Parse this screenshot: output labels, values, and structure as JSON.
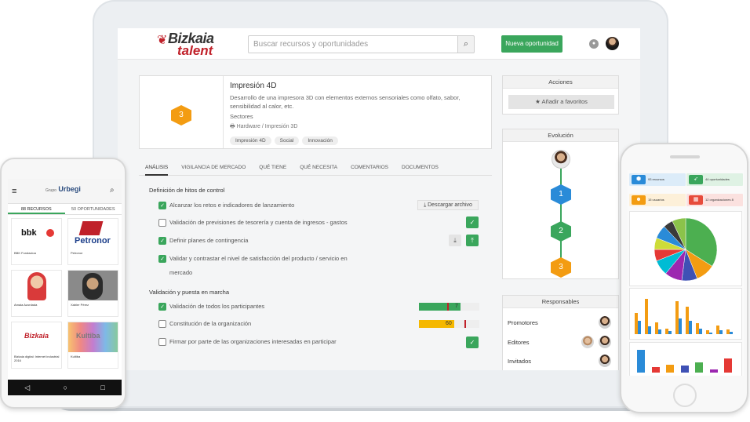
{
  "laptop": {
    "header": {
      "logo_top": "Bizkaia",
      "logo_bottom": "talent",
      "search_placeholder": "Buscar recursos y oportunidades",
      "new_button": "Nueva oportunidad"
    },
    "project": {
      "number": "3",
      "title": "Impresión 4D",
      "description": "Desarrollo de una impresora 3D con elementos externos sensoriales como olfato, sabor, sensibilidad al calor, etc.",
      "sectors_label": "Sectores",
      "category": "Hardware / Impresión 3D",
      "tags": [
        "Impresión 4D",
        "Social",
        "Innovación"
      ]
    },
    "tabs": [
      "ANÁLISIS",
      "VIGILANCIA DE MERCADO",
      "QUÉ TIENE",
      "QUÉ NECESITA",
      "COMENTARIOS",
      "DOCUMENTOS"
    ],
    "section1": {
      "title": "Definición de hitos de control",
      "items": [
        {
          "text": "Alcanzar los retos e indicadores de lanzamiento",
          "checked": true
        },
        {
          "text": "Validación de previsiones de tesorería y cuenta de ingresos - gastos",
          "checked": false
        },
        {
          "text": "Definir planes de contingencia",
          "checked": true
        },
        {
          "text": "Validar y contrastar el nivel de satisfacción del producto / servicio en",
          "checked": true
        },
        {
          "text": "mercado"
        }
      ],
      "download_button": "Descargar archivo"
    },
    "section2": {
      "title": "Validación y puesta en marcha",
      "items": [
        {
          "text": "Validación de todos los participantes",
          "checked": true,
          "score": "7"
        },
        {
          "text": "Constitución de la organización",
          "checked": false,
          "score": "60"
        },
        {
          "text": "Firmar por parte de las organizaciones interesadas en participar",
          "checked": false
        }
      ]
    },
    "sidebar": {
      "actions_title": "Acciones",
      "favorite_button": "Añadir a favoritos",
      "evolution_title": "Evolución",
      "evolution_steps": [
        "1",
        "2",
        "3"
      ],
      "responsables_title": "Responsables",
      "roles": [
        "Promotores",
        "Editores",
        "Invitados"
      ]
    },
    "colors": {
      "green": "#3aa65c",
      "orange": "#f39c12",
      "blue": "#2a8bd8",
      "red": "#c0212a"
    }
  },
  "android": {
    "logo_small": "Grupo",
    "logo": "Urbegi",
    "tabs": [
      "88 RECURSOS",
      "50 OPORTUNIDADES"
    ],
    "cards": [
      {
        "brand": "bbk",
        "title": "BBK Fundazioa"
      },
      {
        "brand": "Petronor",
        "title": "Petronor"
      },
      {
        "brand": "",
        "title": "Amaia Azurdada"
      },
      {
        "brand": "",
        "title": "Xabier Pérez"
      },
      {
        "brand": "Bizkaia",
        "title": "Bizkaia digital: Internet industrial 2016"
      },
      {
        "brand": "Kultiba",
        "title": "Kultiba"
      }
    ]
  },
  "iphone": {
    "stats": [
      {
        "value": "93 recursos",
        "color": "#2a8bd8"
      },
      {
        "value": "44 oportunidades",
        "color": "#3aa65c"
      },
      {
        "value": "15 usuarios",
        "color": "#f39c12"
      },
      {
        "value": "12 organizaciones 8 grupos",
        "color": "#e74c3c"
      }
    ],
    "pie": [
      {
        "value": 34,
        "color": "#4caf50"
      },
      {
        "value": 10,
        "color": "#f39c12"
      },
      {
        "value": 8,
        "color": "#3f51b5"
      },
      {
        "value": 9,
        "color": "#9c27b0"
      },
      {
        "value": 8,
        "color": "#00bcd4"
      },
      {
        "value": 6,
        "color": "#e53935"
      },
      {
        "value": 6,
        "color": "#cddc39"
      },
      {
        "value": 7,
        "color": "#2a8bd8"
      },
      {
        "value": 5,
        "color": "#3a3a3a"
      },
      {
        "value": 7,
        "color": "#8bc34a"
      }
    ],
    "bars_a": [
      {
        "o": 55,
        "b": 35
      },
      {
        "o": 90,
        "b": 20
      },
      {
        "o": 30,
        "b": 12
      },
      {
        "o": 15,
        "b": 8
      },
      {
        "o": 85,
        "b": 40
      },
      {
        "o": 70,
        "b": 35
      },
      {
        "o": 28,
        "b": 15
      },
      {
        "o": 10,
        "b": 5
      },
      {
        "o": 22,
        "b": 10
      },
      {
        "o": 12,
        "b": 6
      }
    ],
    "bars_b": [
      {
        "c": "#2a8bd8",
        "v": 90
      },
      {
        "c": "#e53935",
        "v": 22
      },
      {
        "c": "#f39c12",
        "v": 30
      },
      {
        "c": "#3f51b5",
        "v": 28
      },
      {
        "c": "#4caf50",
        "v": 40
      },
      {
        "c": "#9c27b0",
        "v": 12
      },
      {
        "c": "#e53935",
        "v": 55
      }
    ]
  }
}
